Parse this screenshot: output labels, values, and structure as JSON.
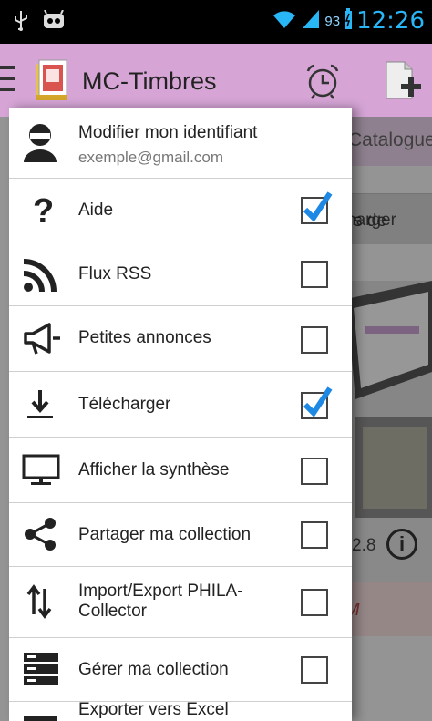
{
  "statusbar": {
    "battery_percent": "93",
    "clock": "12:26"
  },
  "actionbar": {
    "title": "MC-Timbres"
  },
  "background": {
    "tab_label": "Catalogue",
    "button_label": "harger",
    "text_snippet": "s de",
    "version_text": "2.8",
    "red_text": "M"
  },
  "drawer": {
    "account": {
      "title": "Modifier mon identifiant",
      "subtitle": "exemple@gmail.com"
    },
    "items": [
      {
        "label": "Aide",
        "icon": "question-icon",
        "checked": true
      },
      {
        "label": "Flux RSS",
        "icon": "rss-icon",
        "checked": false
      },
      {
        "label": "Petites annonces",
        "icon": "megaphone-icon",
        "checked": false
      },
      {
        "label": "Télécharger",
        "icon": "download-icon",
        "checked": true
      },
      {
        "label": "Afficher la synthèse",
        "icon": "monitor-icon",
        "checked": false
      },
      {
        "label": "Partager ma collection",
        "icon": "share-icon",
        "checked": false
      },
      {
        "label": "Import/Export PHILA-Collector",
        "icon": "import-export-icon",
        "checked": false
      },
      {
        "label": "Gérer ma collection",
        "icon": "server-icon",
        "checked": false
      },
      {
        "label": "Exporter vers Excel",
        "icon": "excel-icon",
        "checked": false
      }
    ]
  }
}
